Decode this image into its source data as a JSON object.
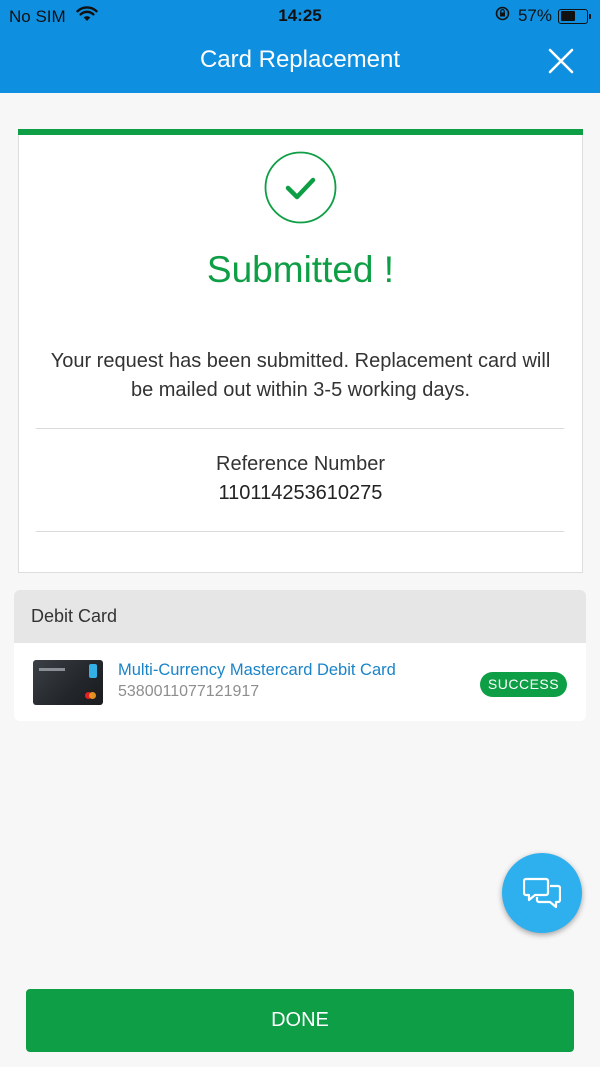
{
  "status_bar": {
    "carrier": "No SIM",
    "time": "14:25",
    "battery": "57%",
    "battery_level": 0.57,
    "icons": [
      "wifi-icon",
      "rotation-lock-icon",
      "battery-icon"
    ]
  },
  "header": {
    "title": "Card Replacement",
    "close_icon": "close-icon"
  },
  "result": {
    "status_icon": "check-icon",
    "status_title": "Submitted !",
    "message": "Your request has been submitted. Replacement card will be mailed out within 3-5 working days.",
    "reference_label": "Reference Number",
    "reference_number": "110114253610275"
  },
  "debit_card": {
    "section_title": "Debit Card",
    "card_name": "Multi-Currency Mastercard Debit Card",
    "card_number": "5380011077121917",
    "status_badge": "SUCCESS"
  },
  "chat": {
    "icon": "chat-bubbles-icon"
  },
  "footer": {
    "done_label": "DONE"
  },
  "colors": {
    "header_blue": "#0f8fe0",
    "success_green": "#0e9e45",
    "link_blue": "#1a84c9",
    "chat_blue": "#2fb0ee"
  }
}
